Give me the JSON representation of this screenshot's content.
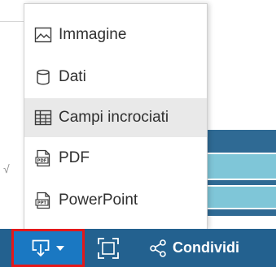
{
  "menu": {
    "items": [
      {
        "label": "Immagine",
        "icon": "image-icon",
        "active": false
      },
      {
        "label": "Dati",
        "icon": "database-icon",
        "active": false
      },
      {
        "label": "Campi incrociati",
        "icon": "crosstab-icon",
        "active": true
      },
      {
        "label": "PDF",
        "icon": "pdf-file-icon",
        "active": false
      },
      {
        "label": "PowerPoint",
        "icon": "ppt-file-icon",
        "active": false
      }
    ]
  },
  "toolbar": {
    "share_label": "Condividi"
  },
  "colors": {
    "toolbar_bg": "#23618f",
    "download_bg": "#1a78c2",
    "highlight_border": "#e4181a",
    "menu_active_bg": "#e9e9e9",
    "chart_dark": "#2f6a94",
    "chart_light": "#7fc6d8"
  },
  "background": {
    "stray_glyph": "√"
  }
}
